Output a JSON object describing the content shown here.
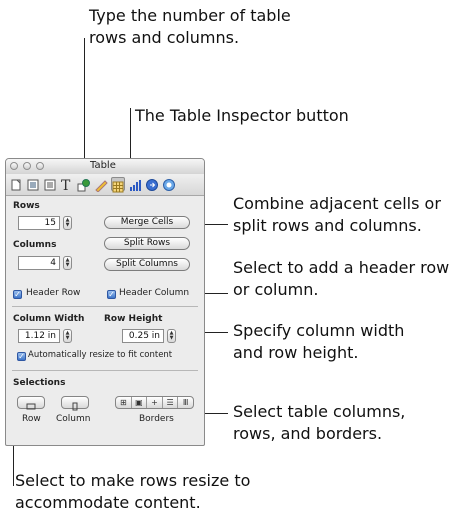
{
  "callouts": {
    "rows_columns": "Type the number of table\nrows and columns.",
    "inspector_button": "The Table Inspector button",
    "merge_split": "Combine adjacent cells or\nsplit rows and columns.",
    "header": "Select to add a header row\nor column.",
    "width_height": "Specify column width\nand row height.",
    "selections": "Select table columns,\nrows, and borders.",
    "auto_resize": "Select to make rows resize to\naccommodate content."
  },
  "window": {
    "title": "Table",
    "toolbar_icons": [
      "document-inspector-icon",
      "layout-inspector-icon",
      "wrap-inspector-icon",
      "text-inspector-icon",
      "graphic-inspector-icon",
      "metrics-inspector-icon",
      "table-inspector-icon",
      "chart-inspector-icon",
      "link-inspector-icon",
      "quicktime-inspector-icon"
    ],
    "selected_tool": "table-inspector-icon"
  },
  "inspector": {
    "rows_label": "Rows",
    "rows_value": "15",
    "columns_label": "Columns",
    "columns_value": "4",
    "merge_cells": "Merge Cells",
    "split_rows": "Split Rows",
    "split_columns": "Split Columns",
    "header_row": "Header Row",
    "header_column": "Header Column",
    "column_width_label": "Column Width",
    "column_width_value": "1.12 in",
    "row_height_label": "Row Height",
    "row_height_value": "0.25 in",
    "auto_resize": "Automatically resize to fit content",
    "selections_label": "Selections",
    "row_label": "Row",
    "column_label": "Column",
    "borders_label": "Borders"
  },
  "colors": {
    "check_blue": "#3e75c9",
    "panel_bg": "#ececec"
  }
}
